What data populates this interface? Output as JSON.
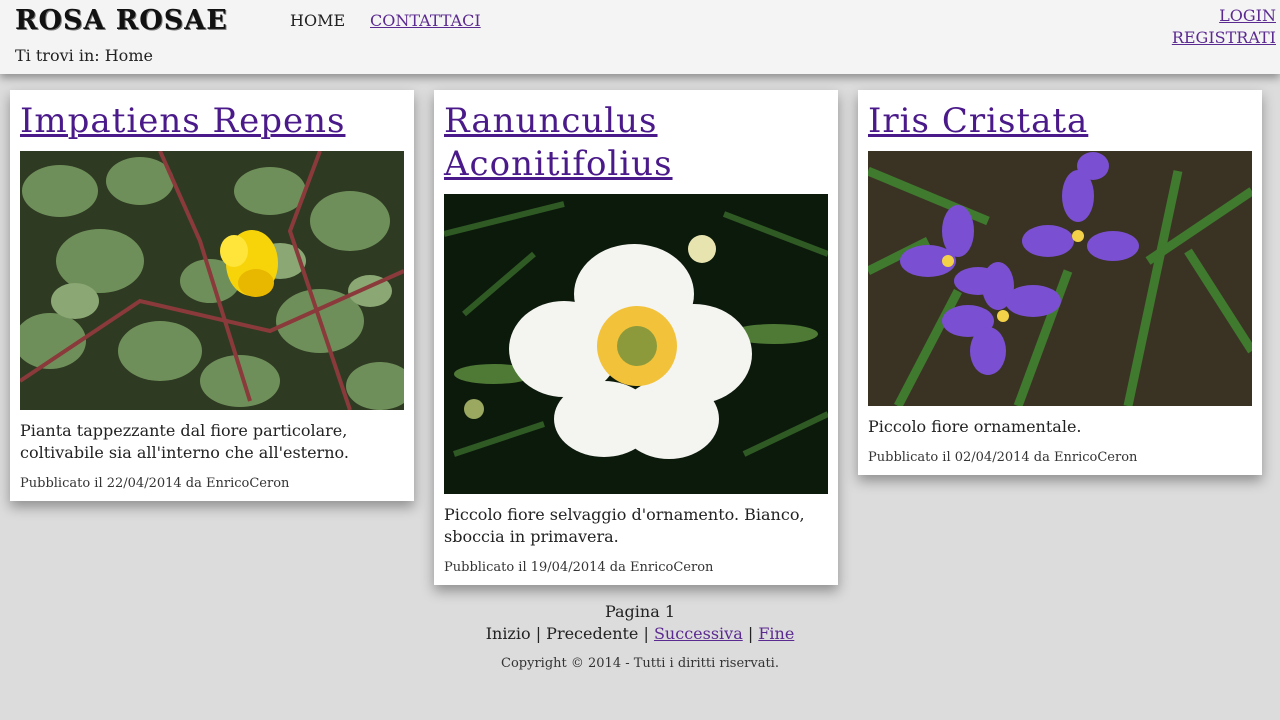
{
  "header": {
    "logo_text": "ROSA ROSAE",
    "nav": {
      "home": "HOME",
      "contact": "CONTATTACI"
    },
    "user": {
      "login": "LOGIN",
      "register": "REGISTRATI"
    },
    "breadcrumb": "Ti trovi in: Home"
  },
  "cards": [
    {
      "title": "Impatiens Repens",
      "description": "Pianta tappezzante dal fiore particolare, coltivabile sia all'interno che all'esterno.",
      "meta": "Pubblicato il 22/04/2014 da EnricoCeron"
    },
    {
      "title": "Ranunculus Aconitifolius",
      "description": "Piccolo fiore selvaggio d'ornamento. Bianco, sboccia in primavera.",
      "meta": "Pubblicato il 19/04/2014 da EnricoCeron"
    },
    {
      "title": "Iris Cristata",
      "description": "Piccolo fiore ornamentale.",
      "meta": "Pubblicato il 02/04/2014 da EnricoCeron"
    }
  ],
  "pager": {
    "page_label": "Pagina 1",
    "first": "Inizio",
    "prev": "Precedente",
    "next": "Successiva",
    "last": "Fine",
    "separator": " | "
  },
  "footer": {
    "copyright": "Copyright © 2014 - Tutti i diritti riservati."
  },
  "colors": {
    "link": "#5b2a91",
    "background": "#dcdcdc",
    "header": "#f4f4f4"
  }
}
